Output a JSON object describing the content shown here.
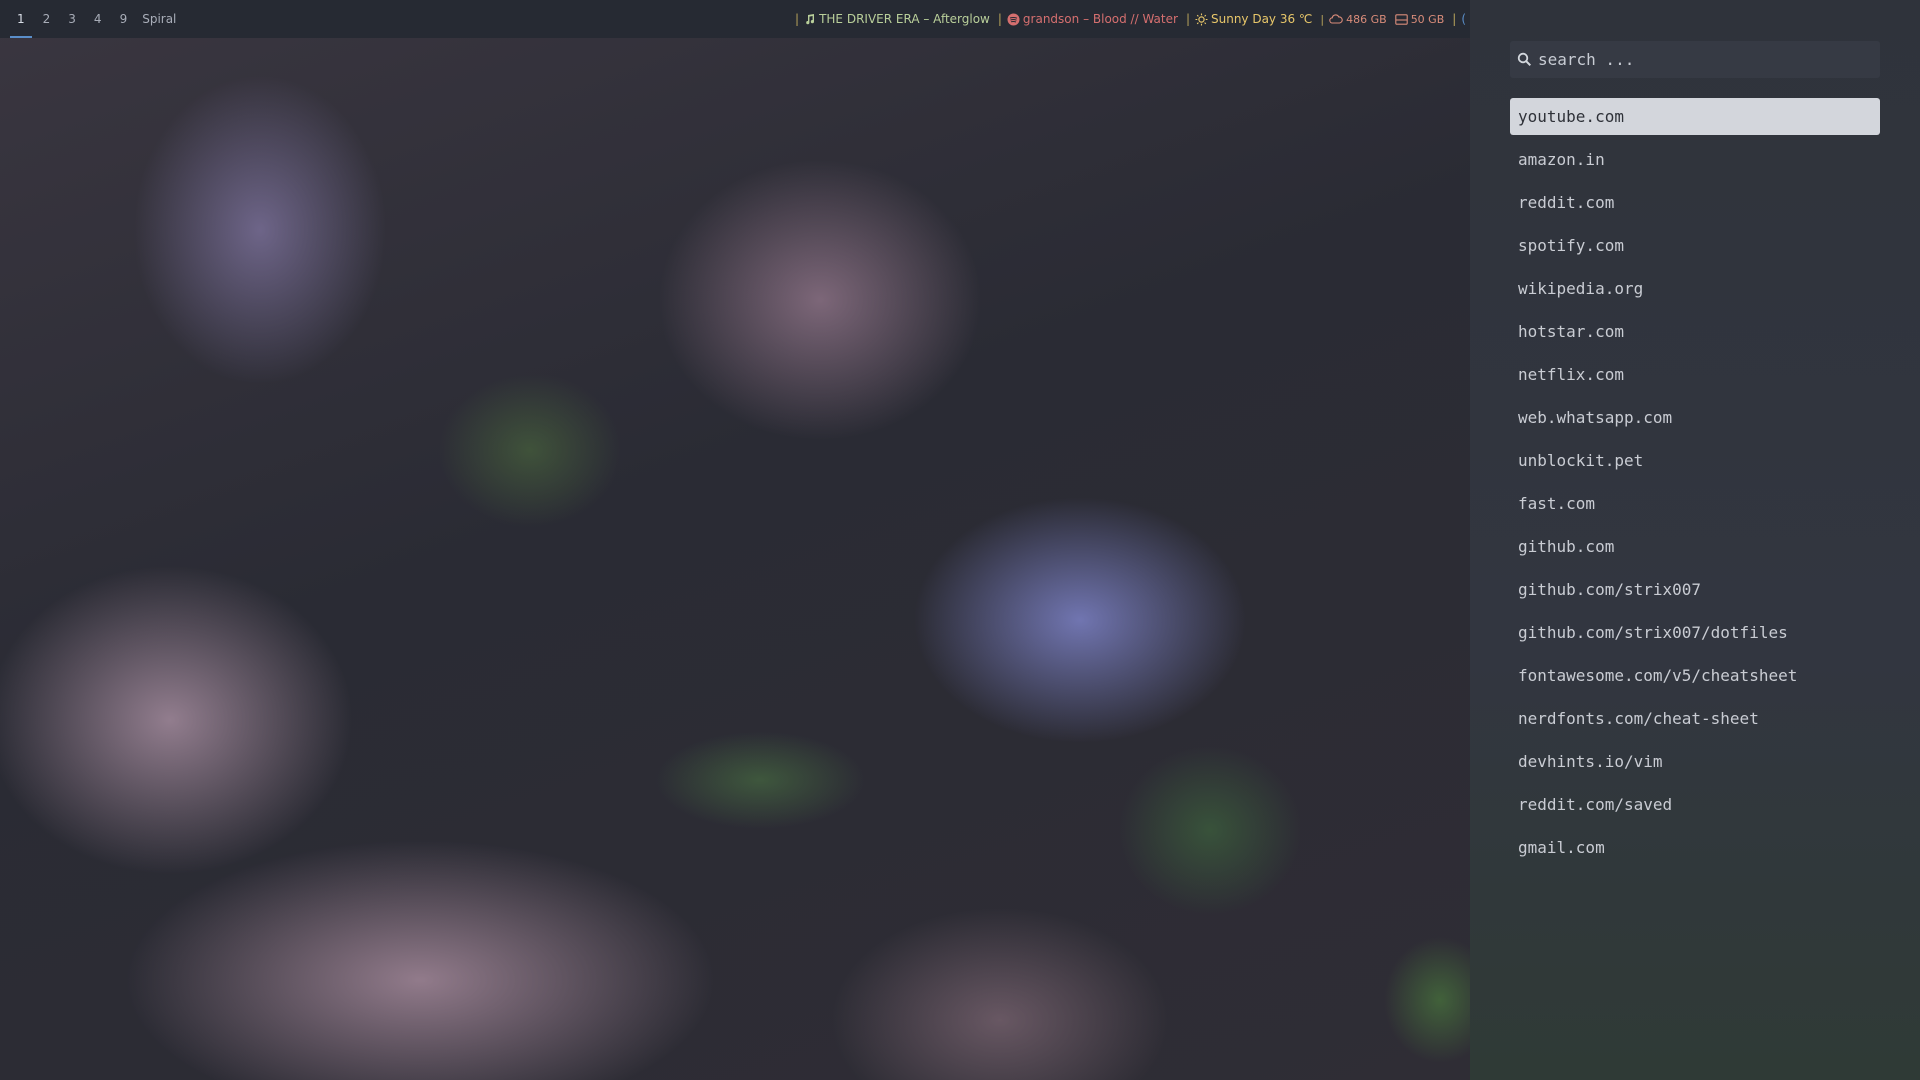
{
  "topbar": {
    "workspaces": [
      "1",
      "2",
      "3",
      "4",
      "9"
    ],
    "active_workspace": "1",
    "layout": "Spiral",
    "music_now": "THE DRIVER ERA – Afterglow",
    "music_next": "grandson – Blood // Water",
    "weather": "Sunny Day 36 ℃",
    "disk_root": "486 GB",
    "disk_home": "50 GB",
    "separator": "|",
    "colors": {
      "accent": "#5a8ec9",
      "music_now": "#b9cf9a",
      "music_next": "#d56f6f",
      "weather": "#e8c76a",
      "disk": "#d98c7a"
    }
  },
  "launcher": {
    "search_placeholder": "search ...",
    "search_icon": "magnifier-icon",
    "results": [
      "youtube.com",
      "amazon.in",
      "reddit.com",
      "spotify.com",
      "wikipedia.org",
      "hotstar.com",
      "netflix.com",
      "web.whatsapp.com",
      "unblockit.pet",
      "fast.com",
      "github.com",
      "github.com/strix007",
      "github.com/strix007/dotfiles",
      "fontawesome.com/v5/cheatsheet",
      "nerdfonts.com/cheat-sheet",
      "devhints.io/vim",
      "reddit.com/saved",
      "gmail.com"
    ],
    "selected_index": 0
  }
}
